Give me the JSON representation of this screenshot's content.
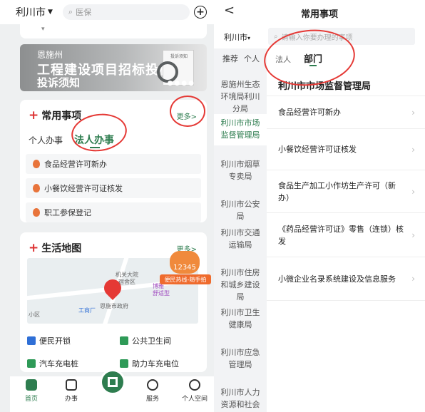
{
  "left": {
    "city": "利川市",
    "search_placeholder": "医保",
    "banner": {
      "tag": "恩施州",
      "title_line1": "工程建设项目招标投标",
      "title_line2": "投诉须知",
      "doc_caption": "投诉须知"
    },
    "common": {
      "title": "常用事项",
      "more": "更多>",
      "tabs": [
        {
          "label": "个人办事",
          "active": false
        },
        {
          "label": "法人办事",
          "active": true
        }
      ],
      "items": [
        "食品经营许可新办",
        "小餐饮经营许可证核发",
        "职工参保登记"
      ]
    },
    "life_map": {
      "title": "生活地图",
      "more": "更多>",
      "map_labels": [
        "机关大院",
        "宿舍区",
        "恩施市政府",
        "工商厂",
        "小区",
        "博雅",
        "舒适型"
      ],
      "hotline_badge": "12345",
      "hotline_text": "便民热线-随手拍"
    },
    "services": [
      {
        "label": "便民开锁",
        "icon": "lock-icon",
        "color": "#2f6fd6"
      },
      {
        "label": "公共卫生间",
        "icon": "toilet-icon",
        "color": "#2e9a57"
      },
      {
        "label": "汽车充电桩",
        "icon": "car-charger-icon",
        "color": "#2e9a57"
      },
      {
        "label": "助力车充电位",
        "icon": "bike-charger-icon",
        "color": "#2e9a57"
      }
    ],
    "bottom_nav": [
      {
        "label": "首页",
        "icon": "home-icon",
        "active": true
      },
      {
        "label": "办事",
        "icon": "document-icon",
        "active": false
      },
      {
        "label": "",
        "icon": "qr-code-icon",
        "active": false
      },
      {
        "label": "服务",
        "icon": "service-icon",
        "active": false
      },
      {
        "label": "个人空间",
        "icon": "user-space-icon",
        "active": false
      }
    ]
  },
  "right": {
    "back_glyph": "<",
    "title": "常用事项",
    "city": "利川市",
    "search_placeholder": "请输入你要办理的事项",
    "side_tabs": [
      "推荐",
      "个人"
    ],
    "departments": [
      "恩施州生态环境局利川分局",
      "利川市市场监督管理局",
      "利川市烟草专卖局",
      "利川市公安局",
      "利川市交通运输局",
      "利川市住房和城乡建设局",
      "利川市卫生健康局",
      "利川市应急管理局",
      "利川市人力资源和社会保障局"
    ],
    "active_department_index": 1,
    "tabs": [
      {
        "label": "法人",
        "active": false
      },
      {
        "label": "部门",
        "active": true
      }
    ],
    "department_title": "利川市市场监督管理局",
    "matters": [
      "食品经营许可新办",
      "小餐饮经营许可证核发",
      "食品生产加工小作坊生产许可（新办）",
      "《药品经营许可证》零售（连锁）核发",
      "小微企业名录系统建设及信息服务"
    ]
  },
  "colors": {
    "accent_green": "#2e7d4f",
    "annotation_red": "#e53935",
    "hotline_orange": "#ef6b2d"
  }
}
